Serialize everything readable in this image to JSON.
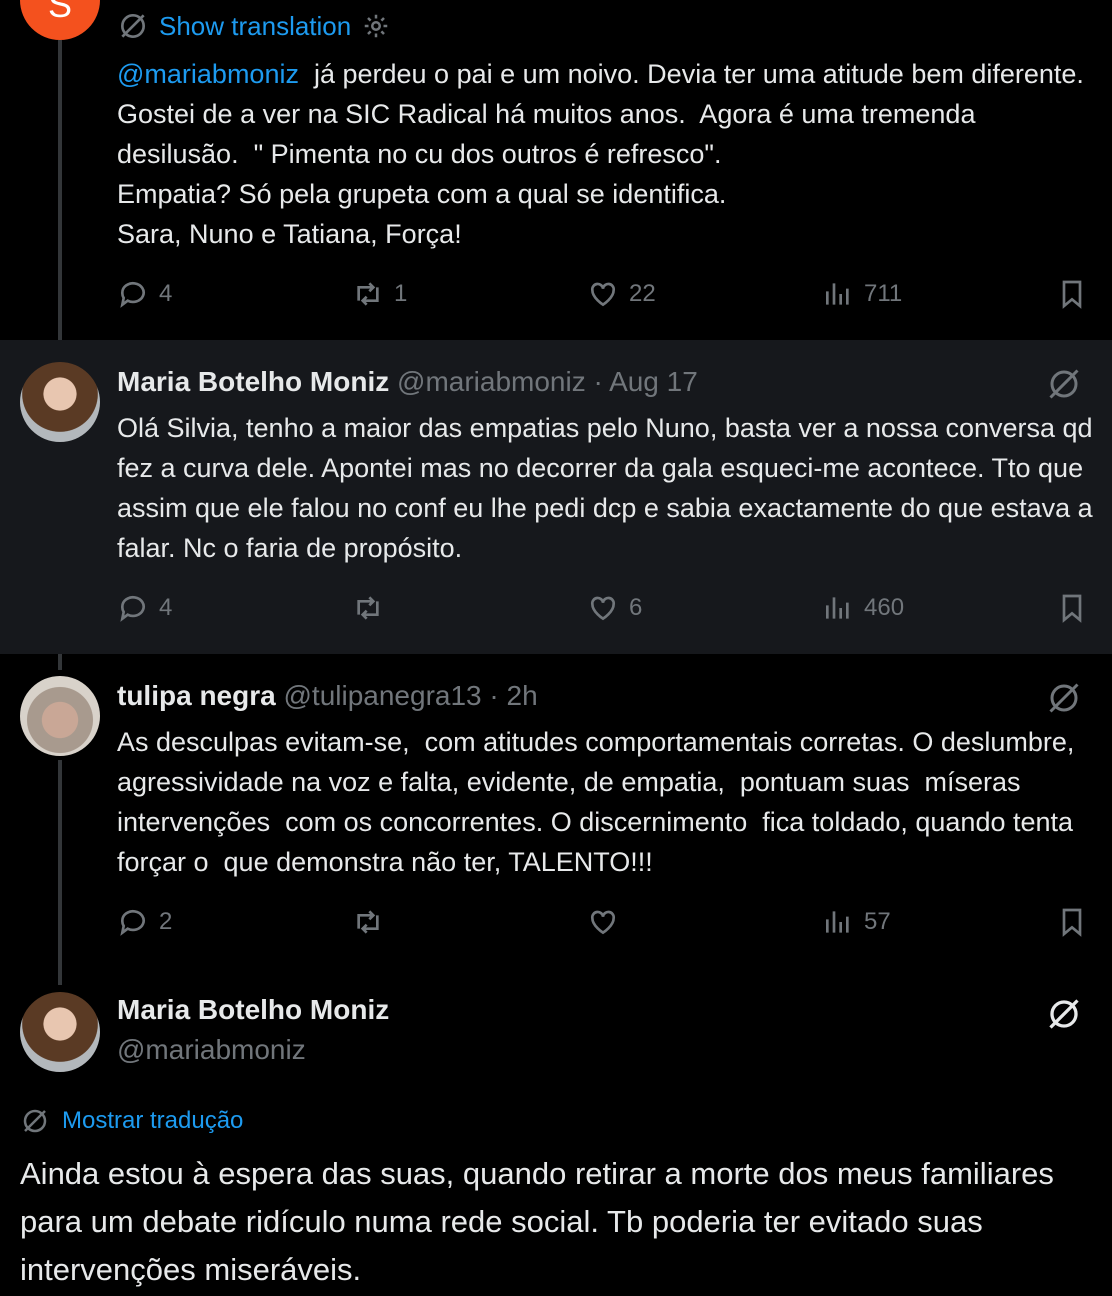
{
  "tweet1": {
    "avatar_letter": "S",
    "avatar_color": "#f4511e",
    "translate_label": "Show translation",
    "mention": "@mariabmoniz",
    "text": "  já perdeu o pai e um noivo. Devia ter uma atitude bem diferente. Gostei de a ver na SIC Radical há muitos anos.  Agora é uma tremenda desilusão.  \" Pimenta no cu dos outros é refresco\".\nEmpatia? Só pela grupeta com a qual se identifica.\nSara, Nuno e Tatiana, Força!",
    "replies": "4",
    "reposts": "1",
    "likes": "22",
    "views": "711"
  },
  "tweet2": {
    "name": "Maria Botelho Moniz",
    "handle": "@mariabmoniz",
    "sep": " · ",
    "time": "Aug 17",
    "text": "Olá Silvia, tenho a maior das empatias pelo Nuno, basta ver a nossa conversa qd fez a curva dele. Apontei mas no decorrer da gala esqueci-me acontece. Tto que assim que ele falou no conf eu lhe pedi dcp e sabia exactamente do que estava a falar. Nc o faria de propósito.",
    "replies": "4",
    "reposts": "",
    "likes": "6",
    "views": "460"
  },
  "tweet3": {
    "name": "tulipa negra",
    "handle": "@tulipanegra13",
    "sep": " · ",
    "time": "2h",
    "text": "As desculpas evitam-se,  com atitudes comportamentais corretas. O deslumbre, agressividade na voz e falta, evidente, de empatia,  pontuam suas  míseras intervenções  com os concorrentes. O discernimento  fica toldado, quando tenta  forçar o  que demonstra não ter, TALENTO!!!",
    "replies": "2",
    "reposts": "",
    "likes": "",
    "views": "57"
  },
  "tweet4": {
    "name": "Maria Botelho Moniz",
    "handle": "@mariabmoniz",
    "translate_label": "Mostrar tradução",
    "text": "Ainda estou à espera das suas, quando retirar a morte dos meus familiares para um debate ridículo numa rede social. Tb poderia ter evitado suas intervenções miseráveis."
  },
  "colors": {
    "background": "#000000",
    "highlight": "#16181c",
    "text": "#e7e9ea",
    "muted": "#71767b",
    "link": "#1d9bf0"
  },
  "icons": [
    "reply-icon",
    "repost-icon",
    "like-icon",
    "views-icon",
    "bookmark-icon",
    "grok-icon",
    "translate-icon",
    "settings-icon"
  ]
}
